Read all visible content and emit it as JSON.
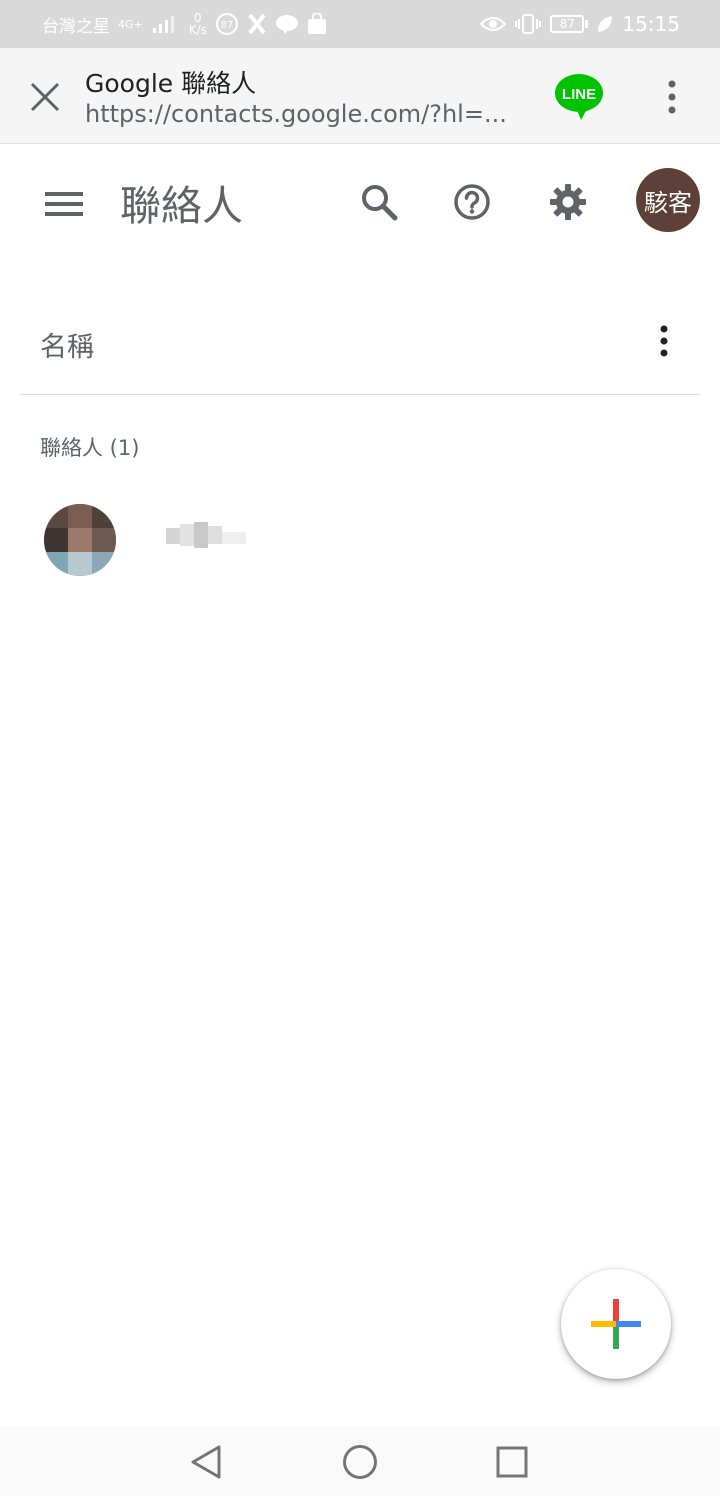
{
  "status_bar": {
    "carrier": "台灣之星",
    "network_type": "4G+",
    "speed_value": "0",
    "speed_unit": "K/s",
    "notification_badge": "87",
    "battery": "87",
    "time": "15:15"
  },
  "custom_tab": {
    "title": "Google 聯絡人",
    "url": "https://contacts.google.com/?hl=...",
    "line_label": "LINE"
  },
  "app_bar": {
    "title": "聯絡人",
    "account_initials": "駭客"
  },
  "list": {
    "sort_label": "名稱",
    "section_label": "聯絡人 (1)",
    "contacts": [
      {
        "name": ""
      }
    ]
  },
  "colors": {
    "line_green": "#00c300",
    "avatar_brown": "#5d4037",
    "google_red": "#ea4335",
    "google_blue": "#4285f4",
    "google_yellow": "#fbbc04",
    "google_green": "#34a853"
  }
}
